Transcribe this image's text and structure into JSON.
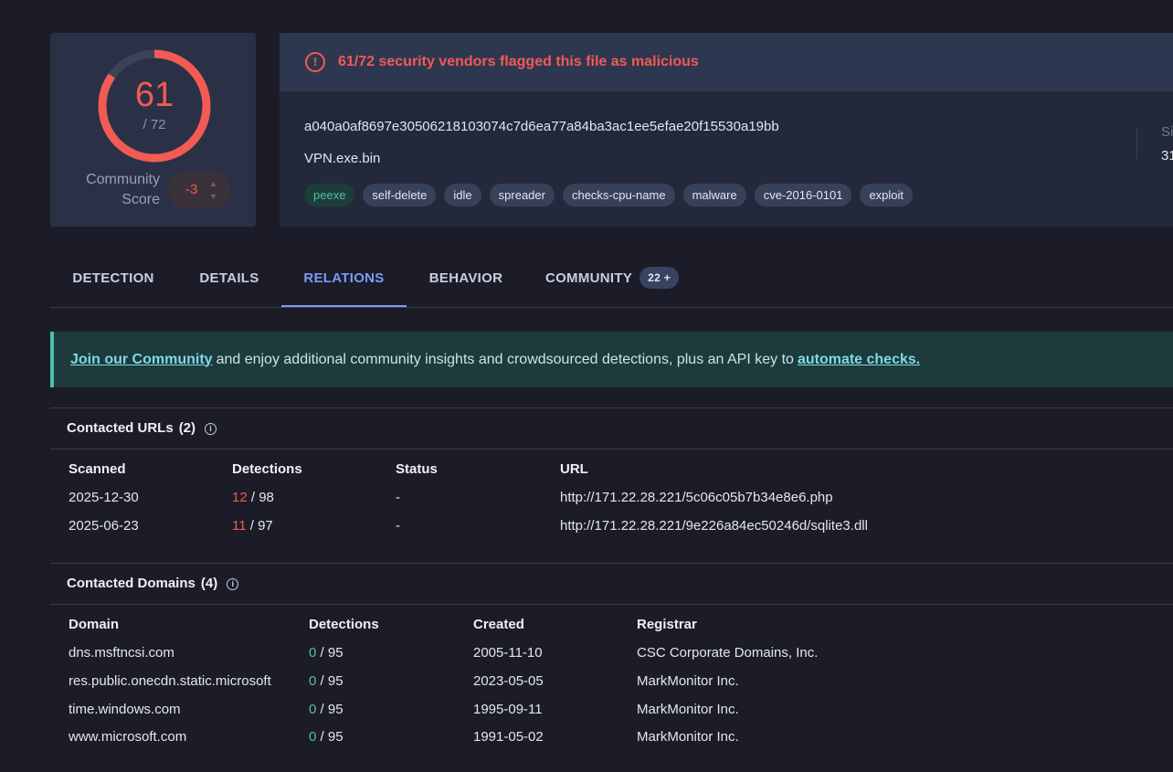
{
  "score": {
    "detected": "61",
    "total": "/ 72",
    "detected_count": 61,
    "total_count": 72,
    "ring_color": "#f25a54"
  },
  "community": {
    "label_line1": "Community",
    "label_line2": "Score",
    "value": "-3"
  },
  "alert": {
    "icon": "exclamation-circle-icon",
    "text": "61/72 security vendors flagged this file as malicious"
  },
  "file": {
    "hash": "a040a0af8697e30506218103074c7d6ea77a84ba3ac1ee5efae20f15530a19bb",
    "name": "VPN.exe.bin",
    "side_label": "Si",
    "side_value": "31"
  },
  "tags": [
    "peexe",
    "self-delete",
    "idle",
    "spreader",
    "checks-cpu-name",
    "malware",
    "cve-2016-0101",
    "exploit"
  ],
  "tabs": [
    {
      "label": "DETECTION"
    },
    {
      "label": "DETAILS"
    },
    {
      "label": "RELATIONS"
    },
    {
      "label": "BEHAVIOR"
    },
    {
      "label": "COMMUNITY",
      "badge": "22 +"
    }
  ],
  "join": {
    "link1": "Join our Community",
    "middle": "and enjoy additional community insights and crowdsourced detections, plus an API key to",
    "link2": "automate checks."
  },
  "urls": {
    "title": "Contacted URLs",
    "count": "(2)",
    "headers": [
      "Scanned",
      "Detections",
      "Status",
      "URL"
    ],
    "rows": [
      {
        "scanned": "2025-12-30",
        "det": "12",
        "det_total": "/ 98",
        "status": "-",
        "url": "http://171.22.28.221/5c06c05b7b34e8e6.php"
      },
      {
        "scanned": "2025-06-23",
        "det": "11",
        "det_total": "/ 97",
        "status": "-",
        "url": "http://171.22.28.221/9e226a84ec50246d/sqlite3.dll"
      }
    ]
  },
  "domains": {
    "title": "Contacted Domains",
    "count": "(4)",
    "headers": [
      "Domain",
      "Detections",
      "Created",
      "Registrar"
    ],
    "rows": [
      {
        "domain": "dns.msftncsi.com",
        "det": "0",
        "det_total": "/ 95",
        "created": "2005-11-10",
        "registrar": "CSC Corporate Domains, Inc."
      },
      {
        "domain": "res.public.onecdn.static.microsoft",
        "det": "0",
        "det_total": "/ 95",
        "created": "2023-05-05",
        "registrar": "MarkMonitor Inc."
      },
      {
        "domain": "time.windows.com",
        "det": "0",
        "det_total": "/ 95",
        "created": "1995-09-11",
        "registrar": "MarkMonitor Inc."
      },
      {
        "domain": "www.microsoft.com",
        "det": "0",
        "det_total": "/ 95",
        "created": "1991-05-02",
        "registrar": "MarkMonitor Inc."
      }
    ]
  }
}
